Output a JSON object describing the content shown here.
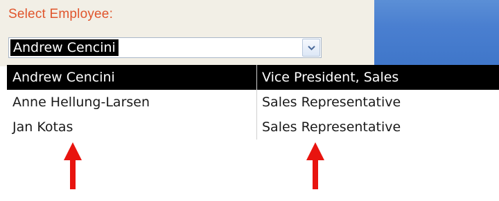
{
  "form": {
    "caption": "Select Employee:",
    "combo_value": "Andrew Cencini"
  },
  "dropdown": {
    "rows": [
      {
        "name": "Andrew Cencini",
        "title": "Vice President, Sales",
        "selected": true
      },
      {
        "name": "Anne Hellung-Larsen",
        "title": "Sales Representative",
        "selected": false
      },
      {
        "name": "Jan Kotas",
        "title": "Sales Representative",
        "selected": false
      }
    ]
  },
  "annotations": {
    "arrow_color": "#e8140f"
  }
}
